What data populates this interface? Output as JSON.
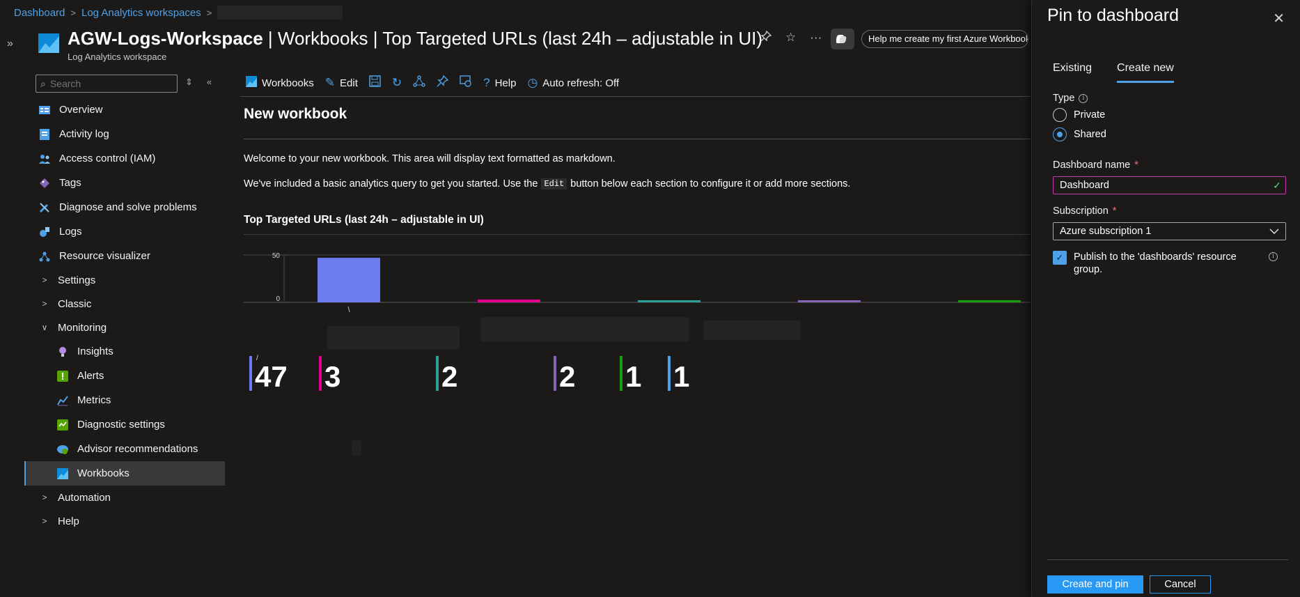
{
  "breadcrumb": {
    "items": [
      "Dashboard",
      "Log Analytics workspaces"
    ]
  },
  "resource": {
    "name": "AGW-Logs-Workspace",
    "title_rest": " | Workbooks | Top Targeted URLs (last 24h – adjustable in UI)",
    "subtitle": "Log Analytics workspace",
    "copilot_prompt": "Help me create my first Azure Workbook"
  },
  "sidebar": {
    "search_placeholder": "Search",
    "items": [
      {
        "label": "Overview",
        "icon": "overview-icon"
      },
      {
        "label": "Activity log",
        "icon": "activity-log-icon"
      },
      {
        "label": "Access control (IAM)",
        "icon": "iam-icon"
      },
      {
        "label": "Tags",
        "icon": "tag-icon"
      },
      {
        "label": "Diagnose and solve problems",
        "icon": "wrench-icon"
      },
      {
        "label": "Logs",
        "icon": "logs-icon"
      },
      {
        "label": "Resource visualizer",
        "icon": "visualizer-icon"
      },
      {
        "label": "Settings",
        "icon": "chevron-right-icon"
      },
      {
        "label": "Classic",
        "icon": "chevron-right-icon"
      },
      {
        "label": "Monitoring",
        "icon": "chevron-down-icon"
      },
      {
        "label": "Insights",
        "icon": "lightbulb-icon"
      },
      {
        "label": "Alerts",
        "icon": "alert-icon"
      },
      {
        "label": "Metrics",
        "icon": "metrics-icon"
      },
      {
        "label": "Diagnostic settings",
        "icon": "diagnostic-icon"
      },
      {
        "label": "Advisor recommendations",
        "icon": "advisor-icon"
      },
      {
        "label": "Workbooks",
        "icon": "workbooks-icon"
      },
      {
        "label": "Automation",
        "icon": "chevron-right-icon"
      },
      {
        "label": "Help",
        "icon": "chevron-right-icon"
      }
    ]
  },
  "toolbar": {
    "workbooks": "Workbooks",
    "edit": "Edit",
    "help": "Help",
    "auto_refresh": "Auto refresh: Off"
  },
  "workbook": {
    "title": "New workbook",
    "md1": "Welcome to your new workbook. This area will display text formatted as markdown.",
    "md2_a": "We've included a basic analytics query to get you started. Use the",
    "md2_code": "Edit",
    "md2_b": "button below each section to configure it or add more sections.",
    "section_title": "Top Targeted URLs (last 24h – adjustable in UI)"
  },
  "chart_data": {
    "type": "bar",
    "categories": [
      "\\",
      "",
      "",
      "",
      ""
    ],
    "values": [
      47,
      3,
      2,
      2,
      1
    ],
    "colors": [
      "#6b7cf0",
      "#e3008c",
      "#2aa198",
      "#8764b8",
      "#13a10e"
    ],
    "yticks": [
      "50",
      "0"
    ],
    "ylim": [
      0,
      50
    ]
  },
  "tiles": [
    {
      "label": "/",
      "value": "47",
      "color": "#6b7cf0"
    },
    {
      "label": "",
      "value": "3",
      "color": "#e3008c"
    },
    {
      "label": "",
      "value": "2",
      "color": "#2aa198"
    },
    {
      "label": "",
      "value": "2",
      "color": "#8764b8"
    },
    {
      "label": "",
      "value": "1",
      "color": "#13a10e"
    },
    {
      "label": "",
      "value": "1",
      "color": "#4ea1e8"
    }
  ],
  "panel": {
    "title": "Pin to dashboard",
    "tabs": [
      "Existing",
      "Create new"
    ],
    "type_label": "Type",
    "radio_private": "Private",
    "radio_shared": "Shared",
    "dashboard_name_label": "Dashboard name",
    "dashboard_name_value": "Dashboard",
    "subscription_label": "Subscription",
    "subscription_value": "Azure subscription 1",
    "publish_label": "Publish to the 'dashboards' resource group.",
    "required_mark": "*",
    "primary_button": "Create and pin",
    "secondary_button": "Cancel"
  },
  "colors": {
    "accent": "#4ea1e8",
    "primary_button": "#2899f5",
    "input_focus": "#c239b3"
  }
}
